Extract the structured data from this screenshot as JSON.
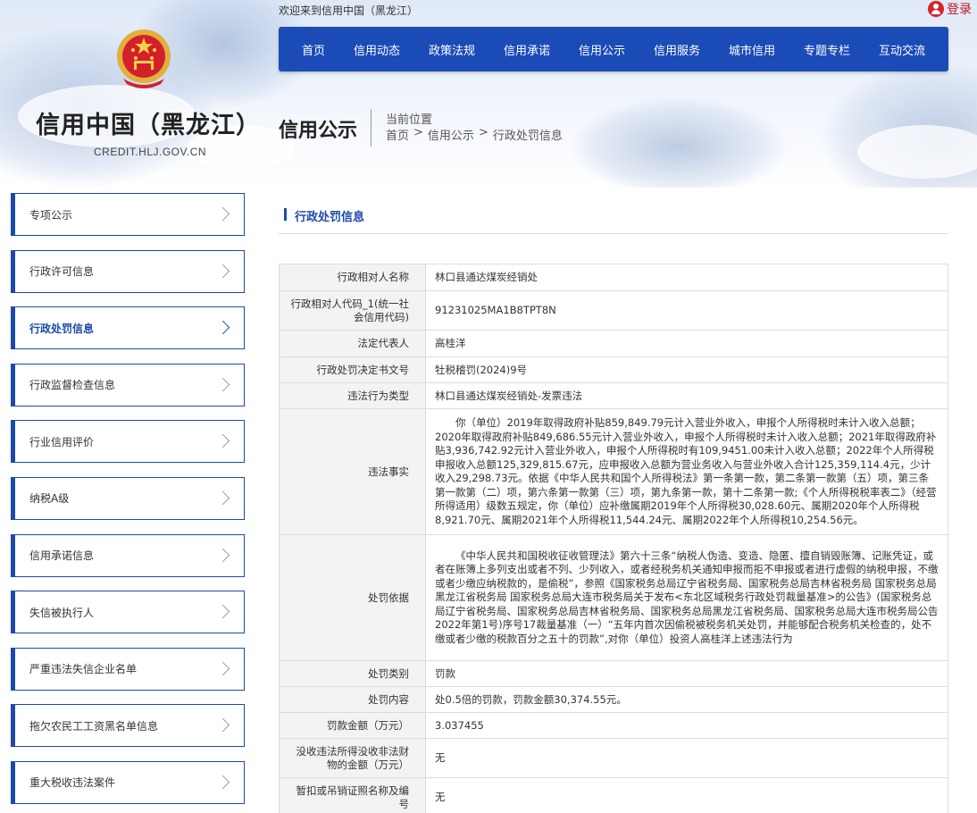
{
  "header": {
    "welcome": "欢迎来到信用中国（黑龙江）",
    "login_label": "登录",
    "site_title": "信用中国（黑龙江）",
    "site_url": "CREDIT.HLJ.GOV.CN",
    "section_title": "信用公示",
    "location_label": "当前位置",
    "breadcrumb": [
      "首页",
      ">",
      "信用公示",
      ">",
      "行政处罚信息"
    ]
  },
  "nav": {
    "items": [
      "首页",
      "信用动态",
      "政策法规",
      "信用承诺",
      "信用公示",
      "信用服务",
      "城市信用",
      "专题专栏",
      "互动交流"
    ]
  },
  "sidebar": {
    "items": [
      {
        "label": "专项公示",
        "active": false
      },
      {
        "label": "行政许可信息",
        "active": false
      },
      {
        "label": "行政处罚信息",
        "active": true
      },
      {
        "label": "行政监督检查信息",
        "active": false
      },
      {
        "label": "行业信用评价",
        "active": false
      },
      {
        "label": "纳税A级",
        "active": false
      },
      {
        "label": "信用承诺信息",
        "active": false
      },
      {
        "label": "失信被执行人",
        "active": false
      },
      {
        "label": "严重违法失信企业名单",
        "active": false
      },
      {
        "label": "拖欠农民工工资黑名单信息",
        "active": false
      },
      {
        "label": "重大税收违法案件",
        "active": false
      }
    ]
  },
  "content": {
    "title": "行政处罚信息",
    "rows": [
      {
        "key": "行政相对人名称",
        "value": "林口县通达煤炭经销处"
      },
      {
        "key": "行政相对人代码_1(统一社会信用代码)",
        "value": "91231025MA1B8TPT8N"
      },
      {
        "key": "法定代表人",
        "value": "高桂洋"
      },
      {
        "key": "行政处罚决定书文号",
        "value": "牡税稽罚(2024)9号"
      },
      {
        "key": "违法行为类型",
        "value": "林口县通达煤炭经销处-发票违法"
      },
      {
        "key": "违法事实",
        "value": "你（单位）2019年取得政府补贴859,849.79元计入营业外收入，申报个人所得税时未计入收入总额；2020年取得政府补贴849,686.55元计入营业外收入，申报个人所得税时未计入收入总额；2021年取得政府补贴3,936,742.92元计入营业外收入，申报个人所得税时有109,9451.00未计入收入总额；2022年个人所得税申报收入总额125,329,815.67元，应申报收入总额为营业务收入与营业外收入合计125,359,114.4元，少计收入29,298.73元。依据《中华人民共和国个人所得税法》第一条第一款，第二条第一款第（五）项，第三条第一款第（二）项，第六条第一款第（三）项，第九条第一款，第十二条第一款;《个人所得税税率表二》（经营所得适用）级数五规定，你（单位）应补缴属期2019年个人所得税30,028.60元、属期2020年个人所得税8,921.70元、属期2021年个人所得税11,544.24元、属期2022年个人所得税10,254.56元。",
        "justify": true
      },
      {
        "key": "处罚依据",
        "value": "《中华人民共和国税收征收管理法》第六十三条“纳税人伪造、变造、隐匿、擅自销毁账簿、记账凭证，或者在账簿上多列支出或者不列、少列收入，或者经税务机关通知申报而拒不申报或者进行虚假的纳税申报，不缴或者少缴应纳税款的，是偷税”，参照《国家税务总局辽宁省税务局、国家税务总局吉林省税务局 国家税务总局黑龙江省税务局 国家税务总局大连市税务局关于发布<东北区域税务行政处罚裁量基准>的公告》(国家税务总局辽宁省税务局、国家税务总局吉林省税务局、国家税务总局黑龙江省税务局、国家税务总局大连市税务局公告2022年第1号)序号17裁量基准（一）“五年内首次因偷税被税务机关处罚，并能够配合税务机关检查的，处不缴或者少缴的税款百分之五十的罚款”,对你（单位）投资人高桂洋上述违法行为",
        "justify": true
      },
      {
        "key": "处罚类别",
        "value": "罚款"
      },
      {
        "key": "处罚内容",
        "value": "处0.5倍的罚款，罚款金额30,374.55元。"
      },
      {
        "key": "罚款金额（万元）",
        "value": "3.037455"
      },
      {
        "key": "没收违法所得没收非法财物的金额（万元）",
        "value": "无"
      },
      {
        "key": "暂扣或吊销证照名称及编号",
        "value": "无"
      }
    ]
  }
}
